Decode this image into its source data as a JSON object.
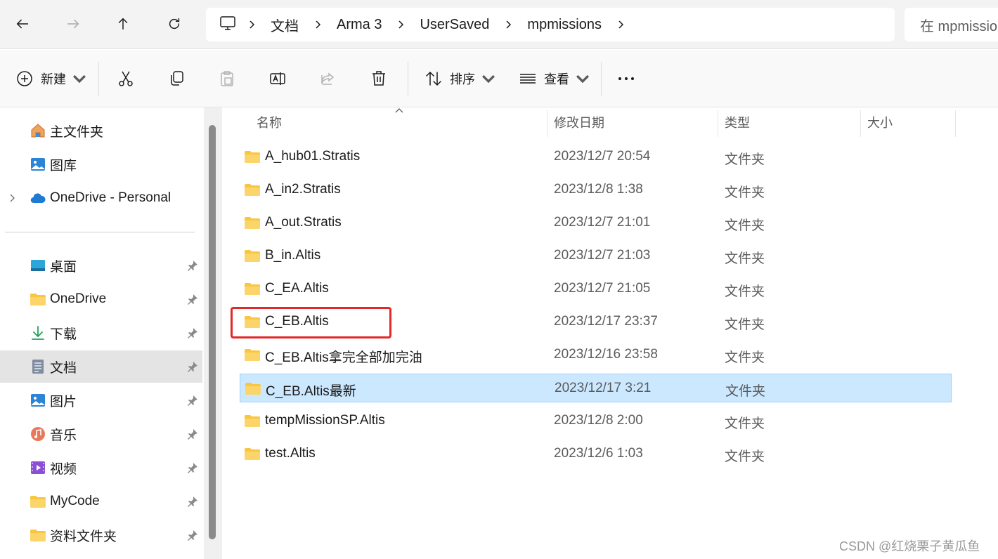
{
  "breadcrumb": {
    "items": [
      "文档",
      "Arma 3",
      "UserSaved",
      "mpmissions"
    ]
  },
  "search": {
    "placeholder": "在 mpmissions"
  },
  "toolbar": {
    "new_label": "新建",
    "sort_label": "排序",
    "view_label": "查看"
  },
  "sidebar": {
    "top_items": [
      {
        "label": "主文件夹",
        "icon": "home-icon"
      },
      {
        "label": "图库",
        "icon": "gallery-icon"
      },
      {
        "label": "OneDrive - Personal",
        "icon": "onedrive-cloud-icon"
      }
    ],
    "quick_access": [
      {
        "label": "桌面",
        "icon": "desktop-icon"
      },
      {
        "label": "OneDrive",
        "icon": "folder-icon"
      },
      {
        "label": "下载",
        "icon": "download-icon"
      },
      {
        "label": "文档",
        "icon": "document-icon",
        "selected": true
      },
      {
        "label": "图片",
        "icon": "pictures-icon"
      },
      {
        "label": "音乐",
        "icon": "music-icon"
      },
      {
        "label": "视频",
        "icon": "video-icon"
      },
      {
        "label": "MyCode",
        "icon": "folder-icon"
      },
      {
        "label": "资料文件夹",
        "icon": "folder-icon"
      }
    ]
  },
  "columns": {
    "name": "名称",
    "modified": "修改日期",
    "type": "类型",
    "size": "大小"
  },
  "files": [
    {
      "name": "A_hub01.Stratis",
      "modified": "2023/12/7 20:54",
      "type": "文件夹"
    },
    {
      "name": "A_in2.Stratis",
      "modified": "2023/12/8 1:38",
      "type": "文件夹"
    },
    {
      "name": "A_out.Stratis",
      "modified": "2023/12/7 21:01",
      "type": "文件夹"
    },
    {
      "name": "B_in.Altis",
      "modified": "2023/12/7 21:03",
      "type": "文件夹"
    },
    {
      "name": "C_EA.Altis",
      "modified": "2023/12/7 21:05",
      "type": "文件夹"
    },
    {
      "name": "C_EB.Altis",
      "modified": "2023/12/17 23:37",
      "type": "文件夹",
      "highlighted": true
    },
    {
      "name": "C_EB.Altis拿完全部加完油",
      "modified": "2023/12/16 23:58",
      "type": "文件夹"
    },
    {
      "name": "C_EB.Altis最新",
      "modified": "2023/12/17 3:21",
      "type": "文件夹",
      "selected": true
    },
    {
      "name": "tempMissionSP.Altis",
      "modified": "2023/12/8 2:00",
      "type": "文件夹"
    },
    {
      "name": "test.Altis",
      "modified": "2023/12/6 1:03",
      "type": "文件夹"
    }
  ],
  "colors": {
    "selection": "#cce8ff",
    "highlight_box": "#e32828",
    "folder": "#f8c640"
  },
  "watermark": "CSDN @红烧栗子黄瓜鱼"
}
